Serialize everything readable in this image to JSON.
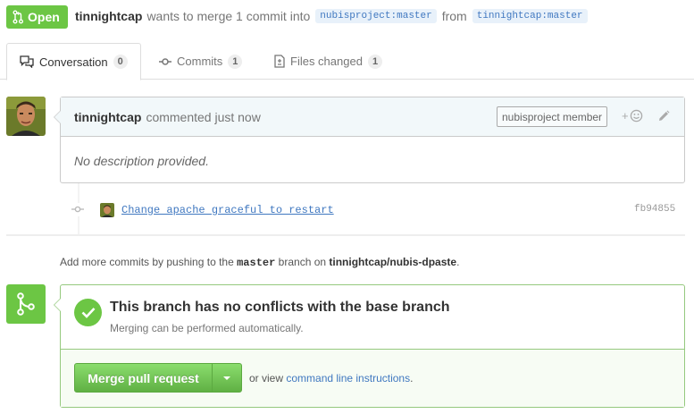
{
  "header": {
    "state": "Open",
    "author": "tinnightcap",
    "action_text": "wants to merge 1 commit into",
    "base_ref": "nubisproject:master",
    "from_text": "from",
    "head_ref": "tinnightcap:master"
  },
  "tabs": [
    {
      "label": "Conversation",
      "count": "0",
      "icon": "conversation-icon",
      "selected": true
    },
    {
      "label": "Commits",
      "count": "1",
      "icon": "commit-icon",
      "selected": false
    },
    {
      "label": "Files changed",
      "count": "1",
      "icon": "file-diff-icon",
      "selected": false
    }
  ],
  "comment": {
    "author": "tinnightcap",
    "action": "commented just now",
    "badge": "nubisproject member",
    "reaction_label": "+",
    "body": "No description provided."
  },
  "commit": {
    "message": "Change apache graceful to restart",
    "sha": "fb94855"
  },
  "push_note": {
    "prefix": "Add more commits by pushing to the",
    "branch": "master",
    "middle": "branch on",
    "repo": "tinnightcap/nubis-dpaste",
    "suffix": "."
  },
  "merge": {
    "title": "This branch has no conflicts with the base branch",
    "subtitle": "Merging can be performed automatically.",
    "button_label": "Merge pull request",
    "or_view": "or view",
    "cli_link": "command line instructions",
    "period": "."
  },
  "colors": {
    "open_green": "#6cc644",
    "link_blue": "#4078c0",
    "comment_header_bg": "#f2f8fa"
  }
}
